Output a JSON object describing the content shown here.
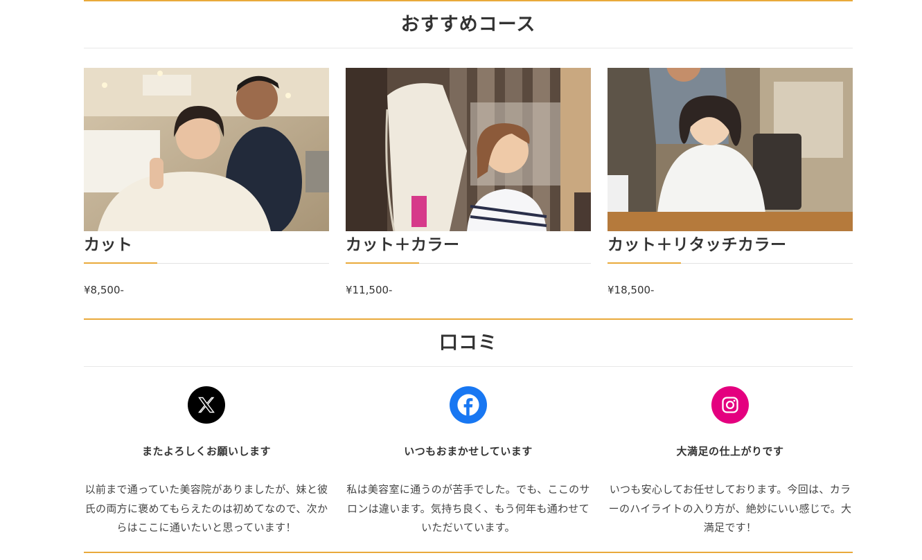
{
  "recommended": {
    "title": "おすすめコース",
    "courses": [
      {
        "name": "カット",
        "price": "¥8,500-"
      },
      {
        "name": "カット＋カラー",
        "price": "¥11,500-"
      },
      {
        "name": "カット＋リタッチカラー",
        "price": "¥18,500-"
      }
    ]
  },
  "reviews": {
    "title": "口コミ",
    "items": [
      {
        "icon": "x-icon",
        "color": "#000000",
        "title": "またよろしくお願いします",
        "body": "以前まで通っていた美容院がありましたが、妹と彼氏の両方に褒めてもらえたのは初めてなので、次からはここに通いたいと思っています！"
      },
      {
        "icon": "facebook-icon",
        "color": "#1877f2",
        "title": "いつもおまかせしています",
        "body": "私は美容室に通うのが苦手でした。でも、ここのサロンは違います。気持ち良く、もう何年も通わせていただいています。"
      },
      {
        "icon": "instagram-icon",
        "color": "#e4007f",
        "title": "大満足の仕上がりです",
        "body": "いつも安心してお任せしております。今回は、カラーのハイライトの入り方が、絶妙にいい感じで。大満足です！"
      }
    ]
  },
  "theme": {
    "accent": "#e9a93a"
  }
}
